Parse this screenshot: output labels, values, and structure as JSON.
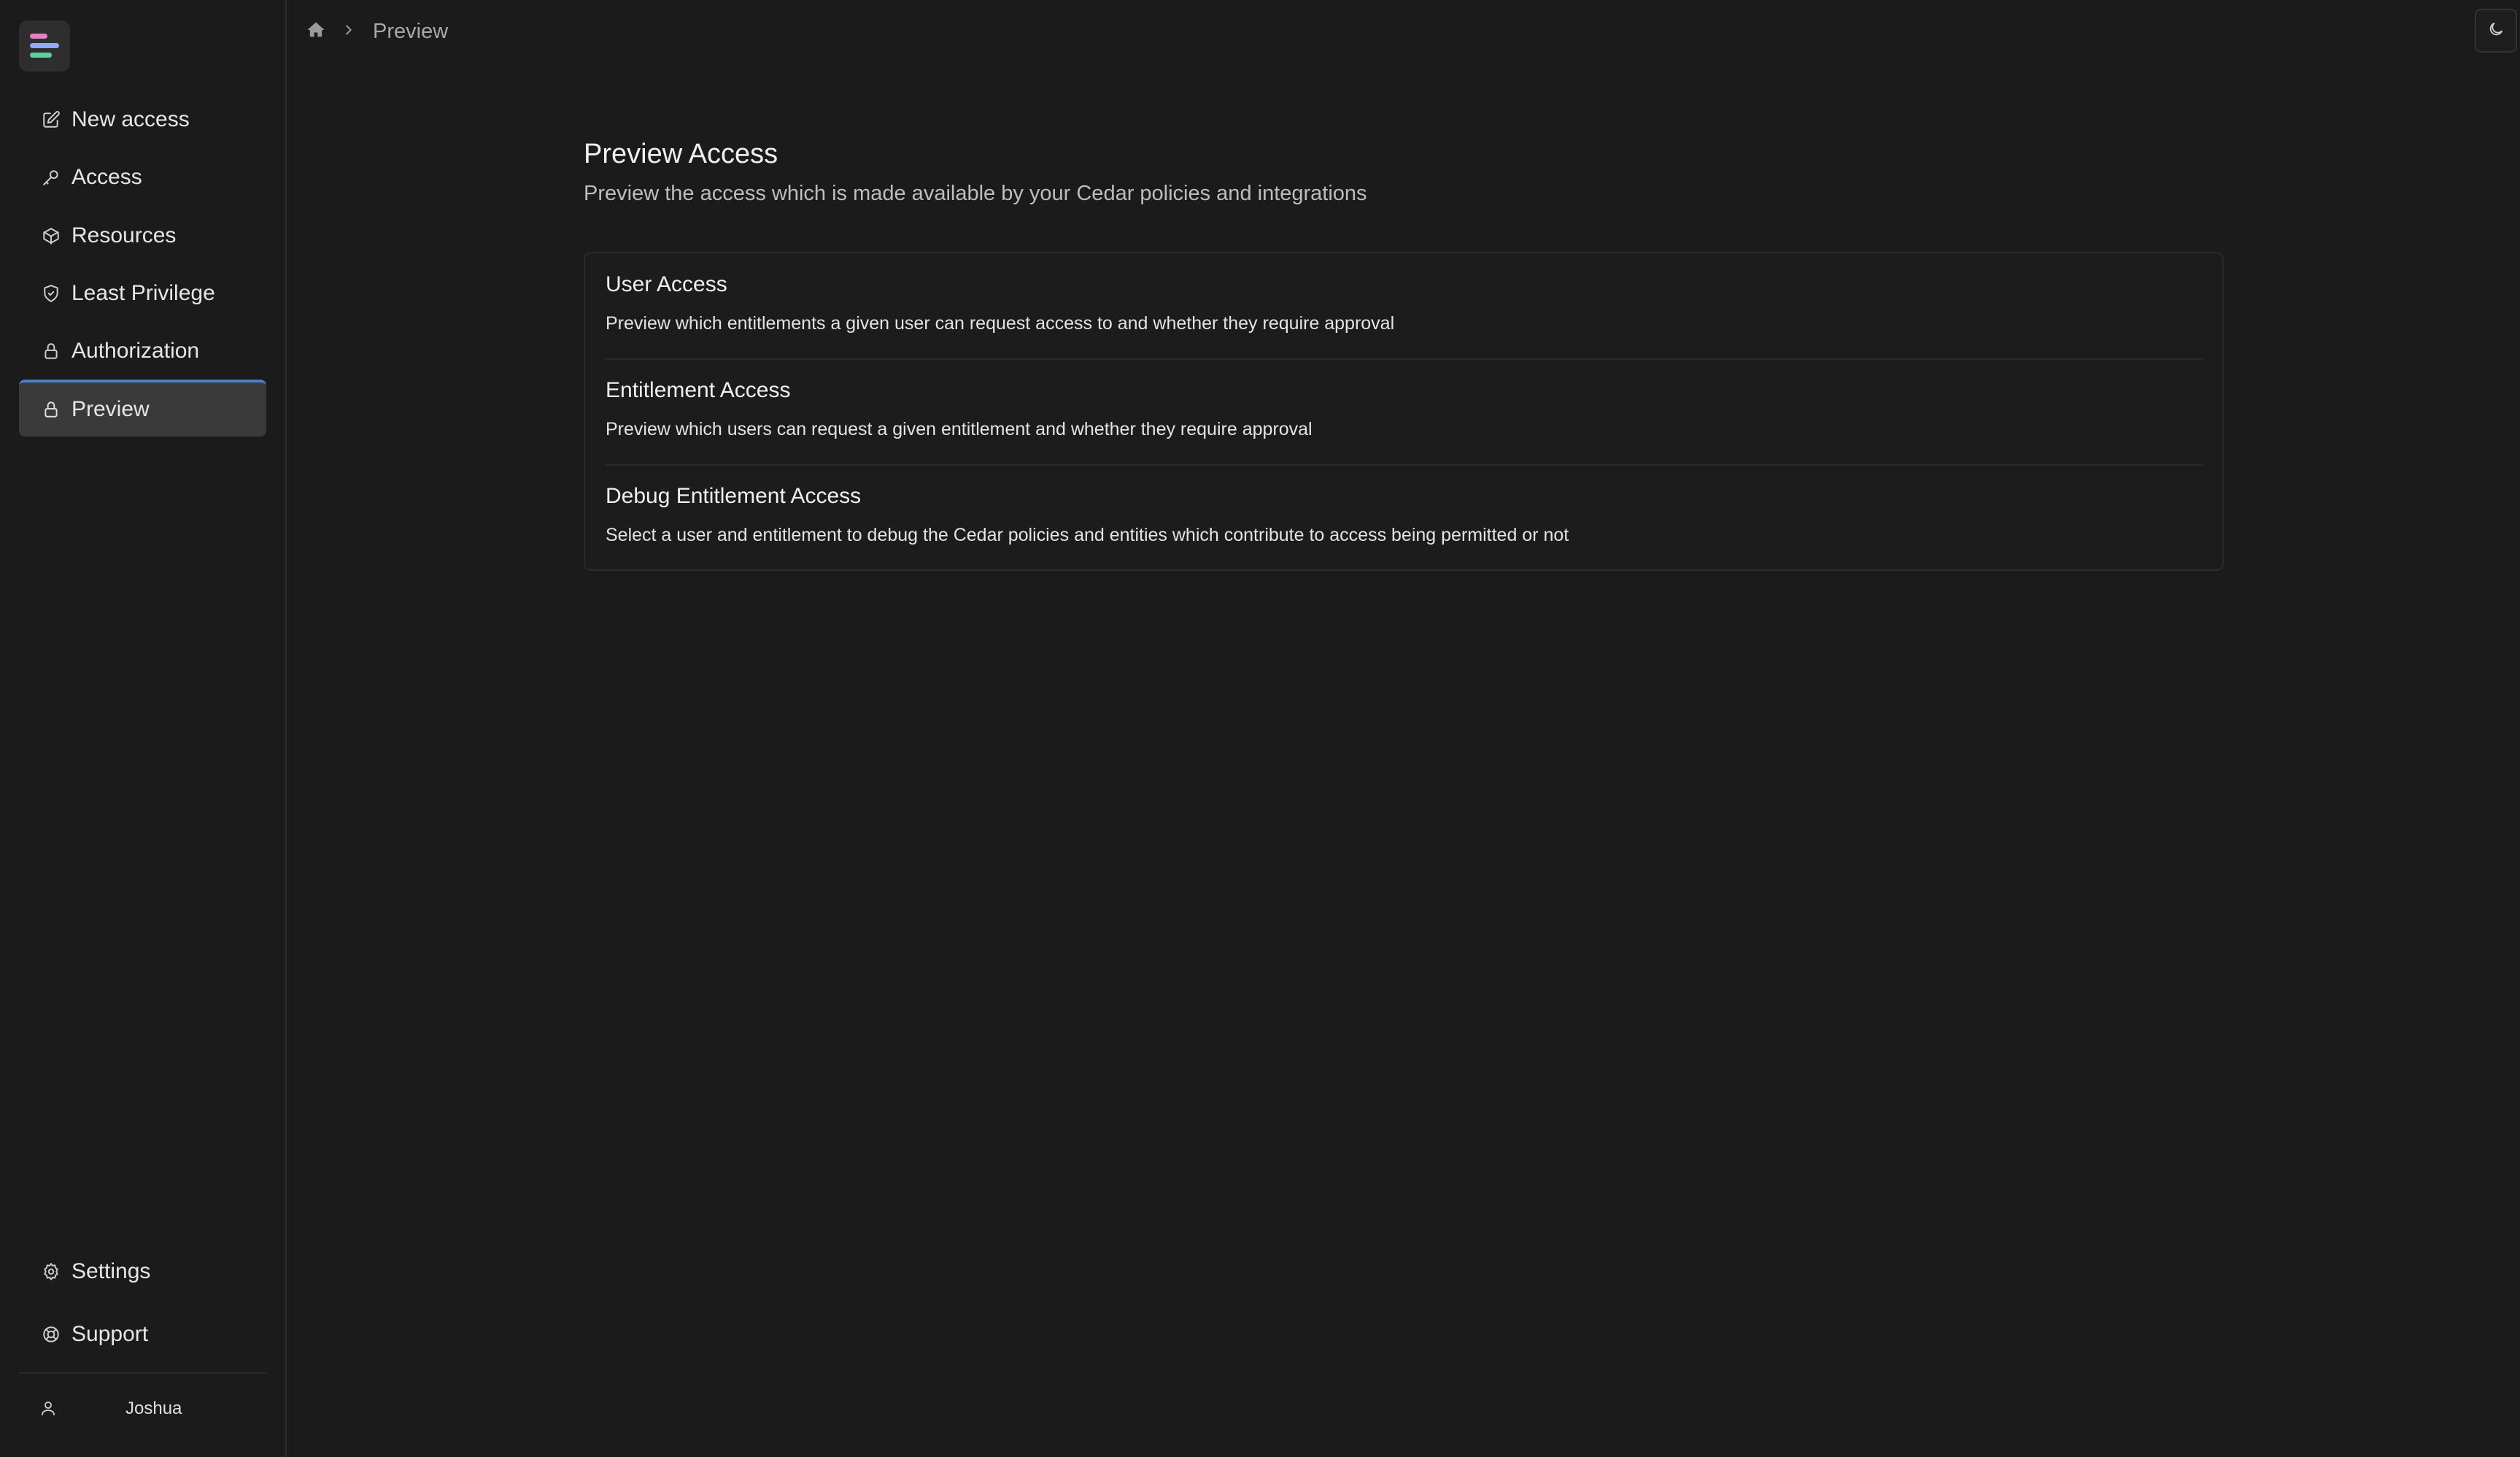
{
  "sidebar": {
    "items": [
      {
        "label": "New access",
        "icon": "pencil-square-icon"
      },
      {
        "label": "Access",
        "icon": "key-icon"
      },
      {
        "label": "Resources",
        "icon": "cube-icon"
      },
      {
        "label": "Least Privilege",
        "icon": "shield-icon"
      },
      {
        "label": "Authorization",
        "icon": "lock-icon"
      },
      {
        "label": "Preview",
        "icon": "lock-icon",
        "active": true
      }
    ],
    "bottom_items": [
      {
        "label": "Settings",
        "icon": "gear-icon"
      },
      {
        "label": "Support",
        "icon": "lifebuoy-icon"
      }
    ],
    "user": {
      "name": "Joshua",
      "icon": "user-icon"
    }
  },
  "breadcrumb": {
    "home_icon": "home-icon",
    "current": "Preview"
  },
  "header": {
    "title": "Preview Access",
    "subtitle": "Preview the access which is made available by your Cedar policies and integrations"
  },
  "options": [
    {
      "title": "User Access",
      "description": "Preview which entitlements a given user can request access to and whether they require approval"
    },
    {
      "title": "Entitlement Access",
      "description": "Preview which users can request a given entitlement and whether they require approval"
    },
    {
      "title": "Debug Entitlement Access",
      "description": "Select a user and entitlement to debug the Cedar policies and entities which contribute to access being permitted or not"
    }
  ],
  "colors": {
    "background": "#1b1b1b",
    "active_nav": "#3a3a3a",
    "active_accent": "#4b82c3"
  }
}
